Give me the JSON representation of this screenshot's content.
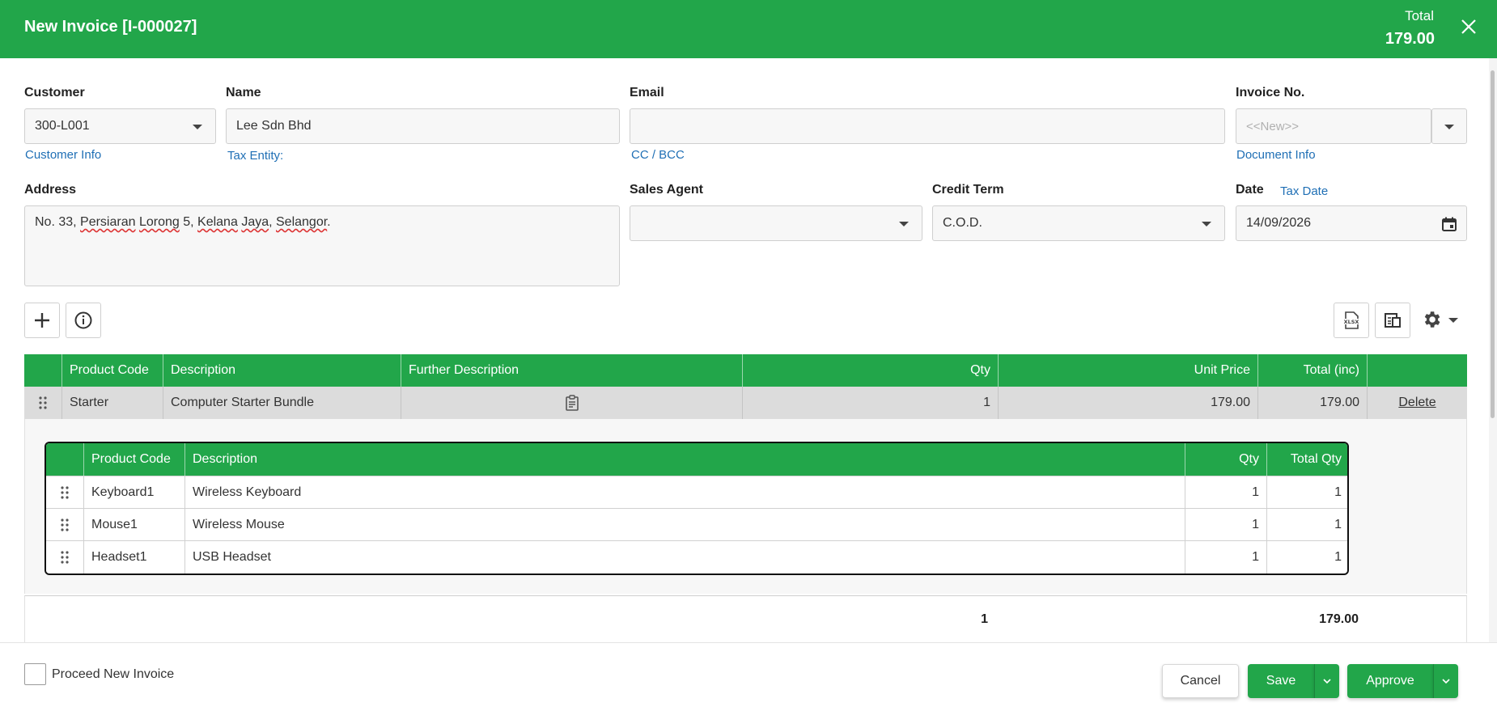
{
  "header": {
    "title": "New Invoice [I-000027]",
    "total_label": "Total",
    "total_value": "179.00"
  },
  "form": {
    "customer": {
      "label": "Customer",
      "value": "300-L001",
      "link": "Customer Info"
    },
    "name": {
      "label": "Name",
      "value": "Lee Sdn Bhd",
      "link": "Tax Entity:"
    },
    "email": {
      "label": "Email",
      "value": "",
      "link": "CC / BCC"
    },
    "invoice_no": {
      "label": "Invoice No.",
      "placeholder": "<<New>>",
      "link": "Document Info"
    },
    "address": {
      "label": "Address",
      "parts": [
        "No. 33, ",
        "Persiaran",
        " ",
        "Lorong",
        " 5, ",
        "Kelana",
        " ",
        "Jaya",
        ", ",
        "Selangor",
        "."
      ]
    },
    "sales_agent": {
      "label": "Sales Agent",
      "value": ""
    },
    "credit_term": {
      "label": "Credit Term",
      "value": "C.O.D."
    },
    "date": {
      "label": "Date",
      "link": "Tax Date",
      "value": "14/09/2026"
    }
  },
  "items_table": {
    "columns": {
      "product_code": "Product Code",
      "description": "Description",
      "further_description": "Further Description",
      "qty": "Qty",
      "unit_price": "Unit Price",
      "total": "Total (inc)"
    },
    "rows": [
      {
        "product_code": "Starter",
        "description": "Computer Starter Bundle",
        "qty": "1",
        "unit_price": "179.00",
        "total": "179.00",
        "action": "Delete"
      }
    ]
  },
  "bundle_table": {
    "columns": {
      "product_code": "Product Code",
      "description": "Description",
      "qty": "Qty",
      "total_qty": "Total Qty"
    },
    "rows": [
      {
        "product_code": "Keyboard1",
        "description": "Wireless Keyboard",
        "qty": "1",
        "total_qty": "1"
      },
      {
        "product_code": "Mouse1",
        "description": "Wireless Mouse",
        "qty": "1",
        "total_qty": "1"
      },
      {
        "product_code": "Headset1",
        "description": "USB Headset",
        "qty": "1",
        "total_qty": "1"
      }
    ]
  },
  "totals": {
    "qty": "1",
    "total": "179.00"
  },
  "footer": {
    "proceed_label": "Proceed New Invoice",
    "cancel": "Cancel",
    "save": "Save",
    "approve": "Approve"
  },
  "colors": {
    "accent": "#22a64a",
    "link": "#1f6fb5"
  },
  "icons": [
    "close-icon",
    "chevron-down-icon",
    "calendar-icon",
    "plus-icon",
    "info-icon",
    "xlsx-icon",
    "import-icon",
    "gear-icon",
    "grip-icon",
    "clipboard-icon"
  ]
}
